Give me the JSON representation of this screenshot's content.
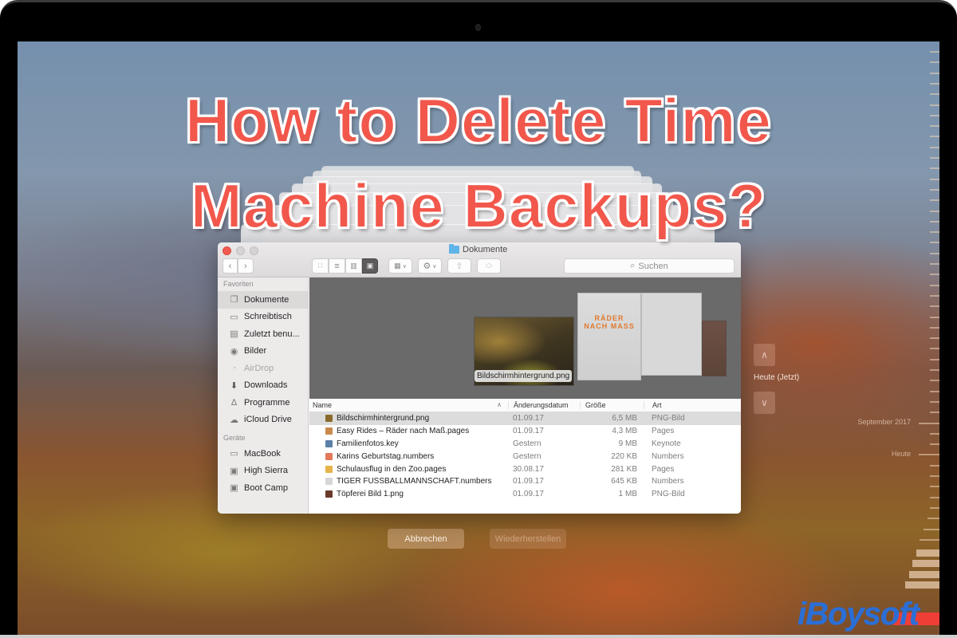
{
  "headline": {
    "line1": "How to Delete Time",
    "line2": "Machine Backups?"
  },
  "finder": {
    "window_title": "Dokumente",
    "toolbar": {
      "back_icon": "chevron-left",
      "forward_icon": "chevron-right",
      "view_icons": [
        "icon-view",
        "list-view",
        "column-view",
        "cover-flow-view"
      ],
      "active_view": "cover-flow-view",
      "arrange_icon": "grid-dropdown",
      "action_icon": "gear-dropdown",
      "share_icon": "share",
      "tags_icon": "tag",
      "search_placeholder": "Suchen"
    },
    "sidebar": {
      "favorites_header": "Favoriten",
      "favorites": [
        {
          "label": "Dokumente",
          "icon": "documents-icon",
          "selected": true
        },
        {
          "label": "Schreibtisch",
          "icon": "desktop-icon"
        },
        {
          "label": "Zuletzt benu...",
          "icon": "recents-icon"
        },
        {
          "label": "Bilder",
          "icon": "camera-icon"
        },
        {
          "label": "AirDrop",
          "icon": "airdrop-icon",
          "dimmed": true
        },
        {
          "label": "Downloads",
          "icon": "download-icon"
        },
        {
          "label": "Programme",
          "icon": "applications-icon"
        },
        {
          "label": "iCloud Drive",
          "icon": "cloud-icon"
        }
      ],
      "devices_header": "Geräte",
      "devices": [
        {
          "label": "MacBook",
          "icon": "laptop-icon"
        },
        {
          "label": "High Sierra",
          "icon": "disk-icon"
        },
        {
          "label": "Boot Camp",
          "icon": "disk-icon"
        }
      ]
    },
    "preview": {
      "selected_label": "Bildschirmhintergrund.png",
      "doc_title": "RÄDER NACH MASS"
    },
    "columns": {
      "name": "Name",
      "date": "Änderungsdatum",
      "size": "Größe",
      "kind": "Art"
    },
    "files": [
      {
        "name": "Bildschirmhintergrund.png",
        "date": "01.09.17",
        "size": "6,5 MB",
        "kind": "PNG-Bild",
        "selected": true,
        "color": "#8a6a2c"
      },
      {
        "name": "Easy Rides – Räder nach Maß.pages",
        "date": "01.09.17",
        "size": "4,3 MB",
        "kind": "Pages",
        "color": "#c98a4b"
      },
      {
        "name": "Familienfotos.key",
        "date": "Gestern",
        "size": "9 MB",
        "kind": "Keynote",
        "color": "#5b7fa8"
      },
      {
        "name": "Karins Geburtstag.numbers",
        "date": "Gestern",
        "size": "220 KB",
        "kind": "Numbers",
        "color": "#e27a5a"
      },
      {
        "name": "Schulausflug in den Zoo.pages",
        "date": "30.08.17",
        "size": "281 KB",
        "kind": "Pages",
        "color": "#e6b34a"
      },
      {
        "name": "TIGER FUSSBALLMANNSCHAFT.numbers",
        "date": "01.09.17",
        "size": "645 KB",
        "kind": "Numbers",
        "color": "#d6d6d6"
      },
      {
        "name": "Töpferei Bild 1.png",
        "date": "01.09.17",
        "size": "1 MB",
        "kind": "PNG-Bild",
        "color": "#6b3a2a"
      }
    ]
  },
  "time_machine": {
    "cancel_label": "Abbrechen",
    "restore_label": "Wiederherstellen",
    "current_label": "Heute (Jetzt)",
    "up_icon": "chevron-up",
    "down_icon": "chevron-down",
    "timeline_labels": [
      "September 2017",
      "Heute"
    ]
  },
  "logo": "iBoysoft"
}
